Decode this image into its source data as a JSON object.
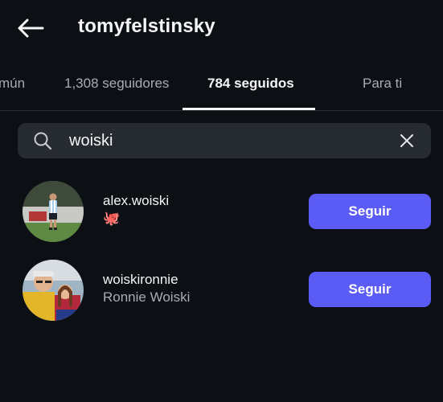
{
  "header": {
    "username": "tomyfelstinsky",
    "back_icon": "arrow-left-icon"
  },
  "tabs": [
    {
      "label": "mún",
      "active": false
    },
    {
      "label": "1,308 seguidores",
      "active": false
    },
    {
      "label": "784 seguidos",
      "active": true
    },
    {
      "label": "Para ti",
      "active": false
    }
  ],
  "search": {
    "value": "woiski",
    "icon": "search-icon",
    "clear_icon": "close-icon"
  },
  "results": [
    {
      "username": "alex.woiski",
      "subtitle": "🐙",
      "button_label": "Seguir",
      "avatar": "avatar-photo"
    },
    {
      "username": "woiskironnie",
      "subtitle": "Ronnie Woiski",
      "button_label": "Seguir",
      "avatar": "avatar-photo"
    }
  ],
  "colors": {
    "background": "#0c0f14",
    "search_bg": "#262a31",
    "button": "#5a5cf5",
    "text_primary": "#f5f5f5",
    "text_secondary": "#a8adb5"
  }
}
